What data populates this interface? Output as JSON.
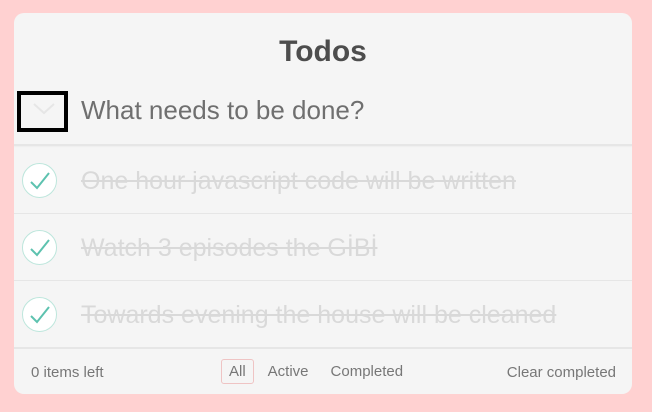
{
  "app": {
    "title": "Todos"
  },
  "new_todo": {
    "placeholder": "What needs to be done?",
    "value": ""
  },
  "todos": [
    {
      "text": "One hour javascript code will be written",
      "completed": true
    },
    {
      "text": "Watch 3 episodes the GİBİ",
      "completed": true
    },
    {
      "text": "Towards evening the house will be cleaned",
      "completed": true
    }
  ],
  "footer": {
    "items_left": "0 items left",
    "filters": [
      "All",
      "Active",
      "Completed"
    ],
    "selected_filter": "All",
    "clear_completed": "Clear completed"
  },
  "colors": {
    "page_background": "#ffd1d1",
    "card_background": "#f5f5f5",
    "check_color": "#5dc2af",
    "completed_text": "#d9d9d9",
    "selected_filter_border": "#efc4c4"
  },
  "icons": {
    "toggle_all": "chevron-down-icon",
    "todo_check": "checkmark-icon"
  }
}
